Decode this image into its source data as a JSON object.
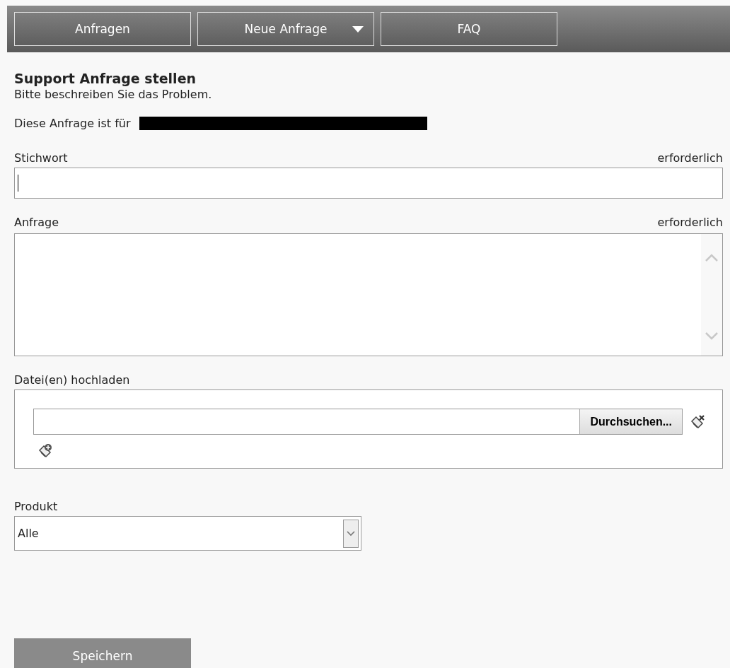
{
  "nav": [
    {
      "label": "Anfragen",
      "kind": "link"
    },
    {
      "label": "Neue Anfrage",
      "kind": "dropdown"
    },
    {
      "label": "FAQ",
      "kind": "link"
    }
  ],
  "form": {
    "title": "Support Anfrage stellen",
    "subtitle": "Bitte beschreiben Sie das Problem.",
    "recipient_label": "Diese Anfrage ist für",
    "recipient_redacted": true,
    "subject": {
      "label": "Stichwort",
      "required_note": "erforderlich"
    },
    "request": {
      "label": "Anfrage",
      "required_note": "erforderlich"
    },
    "upload": {
      "label": "Datei(en) hochladen",
      "browse_button": "Durchsuchen..."
    },
    "product": {
      "label": "Produkt",
      "value": "Alle"
    },
    "save_button": "Speichern"
  }
}
